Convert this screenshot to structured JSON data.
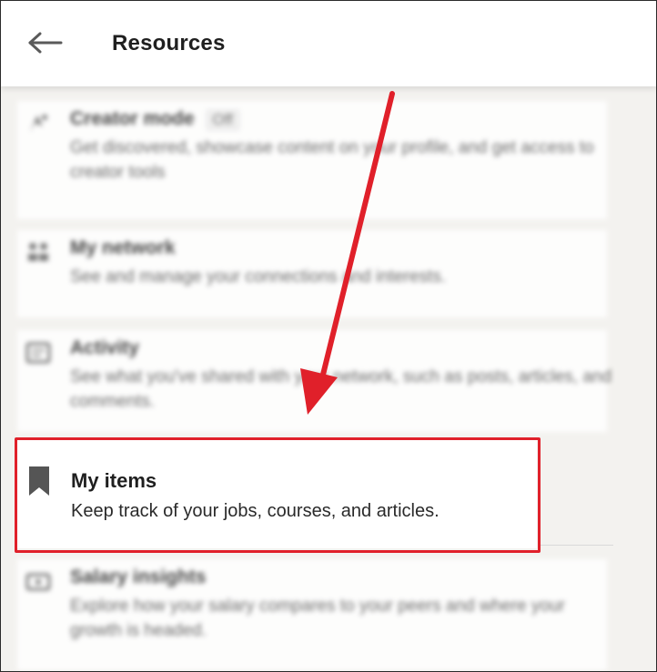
{
  "header": {
    "title": "Resources",
    "back_icon": "arrow-left-icon"
  },
  "items": [
    {
      "icon": "creator-mode-icon",
      "title": "Creator mode",
      "badge": "Off",
      "description": "Get discovered, showcase content on your profile, and get access to creator tools"
    },
    {
      "icon": "network-icon",
      "title": "My network",
      "description": "See and manage your connections and interests."
    },
    {
      "icon": "activity-icon",
      "title": "Activity",
      "description": "See what you've shared with your network, such as posts, articles, and comments."
    },
    {
      "icon": "bookmark-icon",
      "title": "My items",
      "description": "Keep track of your jobs, courses, and articles."
    },
    {
      "icon": "salary-icon",
      "title": "Salary insights",
      "description": "Explore how your salary compares to your peers and where your growth is headed."
    }
  ],
  "annotation": {
    "highlight_color": "#e0202a"
  }
}
